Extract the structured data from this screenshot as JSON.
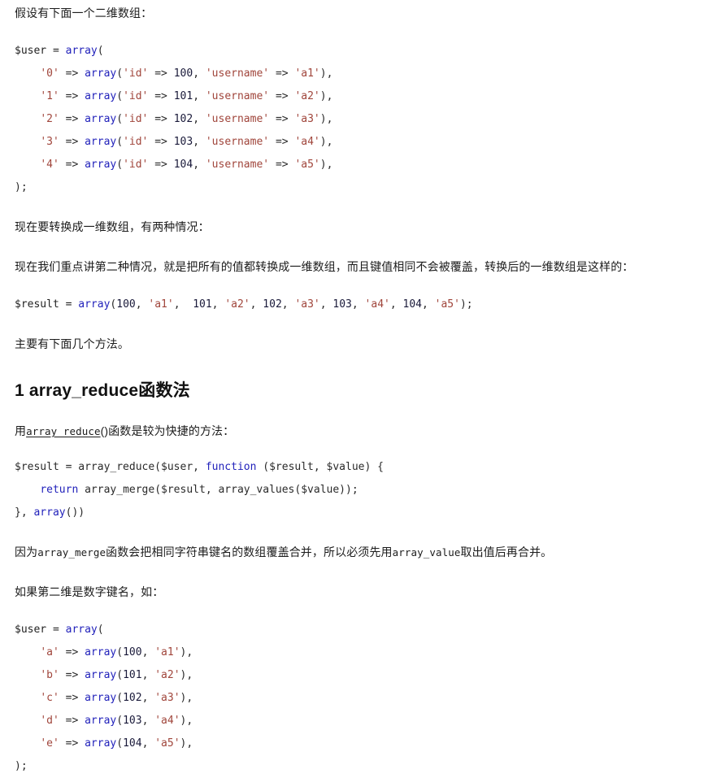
{
  "document": {
    "language": "zh-CN",
    "background_color": "#ffffff",
    "text_color": "#1c1c1c",
    "code_colors": {
      "keyword": "#2222bb",
      "string": "#a0453b",
      "number": "#1a1a3a",
      "punctuation": "#2a2a2a"
    }
  },
  "blocks": {
    "intro_paragraph": "假设有下面一个二维数组：",
    "code_block_1": {
      "lines": [
        [
          {
            "t": "$user = ",
            "c": "var"
          },
          {
            "t": "array",
            "c": "kw"
          },
          {
            "t": "(",
            "c": "pun"
          }
        ],
        [
          {
            "t": "    ",
            "c": "pun"
          },
          {
            "t": "'0'",
            "c": "str"
          },
          {
            "t": " => ",
            "c": "pun"
          },
          {
            "t": "array",
            "c": "kw"
          },
          {
            "t": "(",
            "c": "pun"
          },
          {
            "t": "'id'",
            "c": "str"
          },
          {
            "t": " => ",
            "c": "pun"
          },
          {
            "t": "100",
            "c": "num"
          },
          {
            "t": ", ",
            "c": "pun"
          },
          {
            "t": "'username'",
            "c": "str"
          },
          {
            "t": " => ",
            "c": "pun"
          },
          {
            "t": "'a1'",
            "c": "str"
          },
          {
            "t": "),",
            "c": "pun"
          }
        ],
        [
          {
            "t": "    ",
            "c": "pun"
          },
          {
            "t": "'1'",
            "c": "str"
          },
          {
            "t": " => ",
            "c": "pun"
          },
          {
            "t": "array",
            "c": "kw"
          },
          {
            "t": "(",
            "c": "pun"
          },
          {
            "t": "'id'",
            "c": "str"
          },
          {
            "t": " => ",
            "c": "pun"
          },
          {
            "t": "101",
            "c": "num"
          },
          {
            "t": ", ",
            "c": "pun"
          },
          {
            "t": "'username'",
            "c": "str"
          },
          {
            "t": " => ",
            "c": "pun"
          },
          {
            "t": "'a2'",
            "c": "str"
          },
          {
            "t": "),",
            "c": "pun"
          }
        ],
        [
          {
            "t": "    ",
            "c": "pun"
          },
          {
            "t": "'2'",
            "c": "str"
          },
          {
            "t": " => ",
            "c": "pun"
          },
          {
            "t": "array",
            "c": "kw"
          },
          {
            "t": "(",
            "c": "pun"
          },
          {
            "t": "'id'",
            "c": "str"
          },
          {
            "t": " => ",
            "c": "pun"
          },
          {
            "t": "102",
            "c": "num"
          },
          {
            "t": ", ",
            "c": "pun"
          },
          {
            "t": "'username'",
            "c": "str"
          },
          {
            "t": " => ",
            "c": "pun"
          },
          {
            "t": "'a3'",
            "c": "str"
          },
          {
            "t": "),",
            "c": "pun"
          }
        ],
        [
          {
            "t": "    ",
            "c": "pun"
          },
          {
            "t": "'3'",
            "c": "str"
          },
          {
            "t": " => ",
            "c": "pun"
          },
          {
            "t": "array",
            "c": "kw"
          },
          {
            "t": "(",
            "c": "pun"
          },
          {
            "t": "'id'",
            "c": "str"
          },
          {
            "t": " => ",
            "c": "pun"
          },
          {
            "t": "103",
            "c": "num"
          },
          {
            "t": ", ",
            "c": "pun"
          },
          {
            "t": "'username'",
            "c": "str"
          },
          {
            "t": " => ",
            "c": "pun"
          },
          {
            "t": "'a4'",
            "c": "str"
          },
          {
            "t": "),",
            "c": "pun"
          }
        ],
        [
          {
            "t": "    ",
            "c": "pun"
          },
          {
            "t": "'4'",
            "c": "str"
          },
          {
            "t": " => ",
            "c": "pun"
          },
          {
            "t": "array",
            "c": "kw"
          },
          {
            "t": "(",
            "c": "pun"
          },
          {
            "t": "'id'",
            "c": "str"
          },
          {
            "t": " => ",
            "c": "pun"
          },
          {
            "t": "104",
            "c": "num"
          },
          {
            "t": ", ",
            "c": "pun"
          },
          {
            "t": "'username'",
            "c": "str"
          },
          {
            "t": " => ",
            "c": "pun"
          },
          {
            "t": "'a5'",
            "c": "str"
          },
          {
            "t": "),",
            "c": "pun"
          }
        ],
        [
          {
            "t": ");",
            "c": "pun"
          }
        ]
      ]
    },
    "paragraph_2": "现在要转换成一维数组，有两种情况：",
    "paragraph_3": "现在我们重点讲第二种情况，就是把所有的值都转换成一维数组，而且键值相同不会被覆盖，转换后的一维数组是这样的：",
    "code_block_2": {
      "lines": [
        [
          {
            "t": "$result = ",
            "c": "var"
          },
          {
            "t": "array",
            "c": "kw"
          },
          {
            "t": "(",
            "c": "pun"
          },
          {
            "t": "100",
            "c": "num"
          },
          {
            "t": ", ",
            "c": "pun"
          },
          {
            "t": "'a1'",
            "c": "str"
          },
          {
            "t": ",  ",
            "c": "pun"
          },
          {
            "t": "101",
            "c": "num"
          },
          {
            "t": ", ",
            "c": "pun"
          },
          {
            "t": "'a2'",
            "c": "str"
          },
          {
            "t": ", ",
            "c": "pun"
          },
          {
            "t": "102",
            "c": "num"
          },
          {
            "t": ", ",
            "c": "pun"
          },
          {
            "t": "'a3'",
            "c": "str"
          },
          {
            "t": ", ",
            "c": "pun"
          },
          {
            "t": "103",
            "c": "num"
          },
          {
            "t": ", ",
            "c": "pun"
          },
          {
            "t": "'a4'",
            "c": "str"
          },
          {
            "t": ", ",
            "c": "pun"
          },
          {
            "t": "104",
            "c": "num"
          },
          {
            "t": ", ",
            "c": "pun"
          },
          {
            "t": "'a5'",
            "c": "str"
          },
          {
            "t": ");",
            "c": "pun"
          }
        ]
      ]
    },
    "paragraph_4": "主要有下面几个方法。",
    "heading_1": "1 array_reduce函数法",
    "paragraph_5": {
      "prefix": "用",
      "code_underlined": "array_reduce",
      "middle": "()",
      "suffix": "函数是较为快捷的方法："
    },
    "code_block_3": {
      "lines": [
        [
          {
            "t": "$result = array_reduce($user, ",
            "c": "pun"
          },
          {
            "t": "function",
            "c": "kw"
          },
          {
            "t": " ($result, $value) {",
            "c": "pun"
          }
        ],
        [
          {
            "t": "    ",
            "c": "pun"
          },
          {
            "t": "return",
            "c": "kw"
          },
          {
            "t": " array_merge($result, array_values($value));",
            "c": "pun"
          }
        ],
        [
          {
            "t": "}, ",
            "c": "pun"
          },
          {
            "t": "array",
            "c": "kw"
          },
          {
            "t": "())",
            "c": "pun"
          }
        ]
      ]
    },
    "paragraph_6": {
      "prefix": "因为",
      "code_1": "array_merge",
      "middle": "函数会把相同字符串键名的数组覆盖合并，所以必须先用",
      "code_2": "array_value",
      "suffix": "取出值后再合并。"
    },
    "paragraph_7": "如果第二维是数字键名，如：",
    "code_block_4": {
      "lines": [
        [
          {
            "t": "$user = ",
            "c": "var"
          },
          {
            "t": "array",
            "c": "kw"
          },
          {
            "t": "(",
            "c": "pun"
          }
        ],
        [
          {
            "t": "    ",
            "c": "pun"
          },
          {
            "t": "'a'",
            "c": "str"
          },
          {
            "t": " => ",
            "c": "pun"
          },
          {
            "t": "array",
            "c": "kw"
          },
          {
            "t": "(",
            "c": "pun"
          },
          {
            "t": "100",
            "c": "num"
          },
          {
            "t": ", ",
            "c": "pun"
          },
          {
            "t": "'a1'",
            "c": "str"
          },
          {
            "t": "),",
            "c": "pun"
          }
        ],
        [
          {
            "t": "    ",
            "c": "pun"
          },
          {
            "t": "'b'",
            "c": "str"
          },
          {
            "t": " => ",
            "c": "pun"
          },
          {
            "t": "array",
            "c": "kw"
          },
          {
            "t": "(",
            "c": "pun"
          },
          {
            "t": "101",
            "c": "num"
          },
          {
            "t": ", ",
            "c": "pun"
          },
          {
            "t": "'a2'",
            "c": "str"
          },
          {
            "t": "),",
            "c": "pun"
          }
        ],
        [
          {
            "t": "    ",
            "c": "pun"
          },
          {
            "t": "'c'",
            "c": "str"
          },
          {
            "t": " => ",
            "c": "pun"
          },
          {
            "t": "array",
            "c": "kw"
          },
          {
            "t": "(",
            "c": "pun"
          },
          {
            "t": "102",
            "c": "num"
          },
          {
            "t": ", ",
            "c": "pun"
          },
          {
            "t": "'a3'",
            "c": "str"
          },
          {
            "t": "),",
            "c": "pun"
          }
        ],
        [
          {
            "t": "    ",
            "c": "pun"
          },
          {
            "t": "'d'",
            "c": "str"
          },
          {
            "t": " => ",
            "c": "pun"
          },
          {
            "t": "array",
            "c": "kw"
          },
          {
            "t": "(",
            "c": "pun"
          },
          {
            "t": "103",
            "c": "num"
          },
          {
            "t": ", ",
            "c": "pun"
          },
          {
            "t": "'a4'",
            "c": "str"
          },
          {
            "t": "),",
            "c": "pun"
          }
        ],
        [
          {
            "t": "    ",
            "c": "pun"
          },
          {
            "t": "'e'",
            "c": "str"
          },
          {
            "t": " => ",
            "c": "pun"
          },
          {
            "t": "array",
            "c": "kw"
          },
          {
            "t": "(",
            "c": "pun"
          },
          {
            "t": "104",
            "c": "num"
          },
          {
            "t": ", ",
            "c": "pun"
          },
          {
            "t": "'a5'",
            "c": "str"
          },
          {
            "t": "),",
            "c": "pun"
          }
        ],
        [
          {
            "t": ");",
            "c": "pun"
          }
        ]
      ]
    }
  }
}
